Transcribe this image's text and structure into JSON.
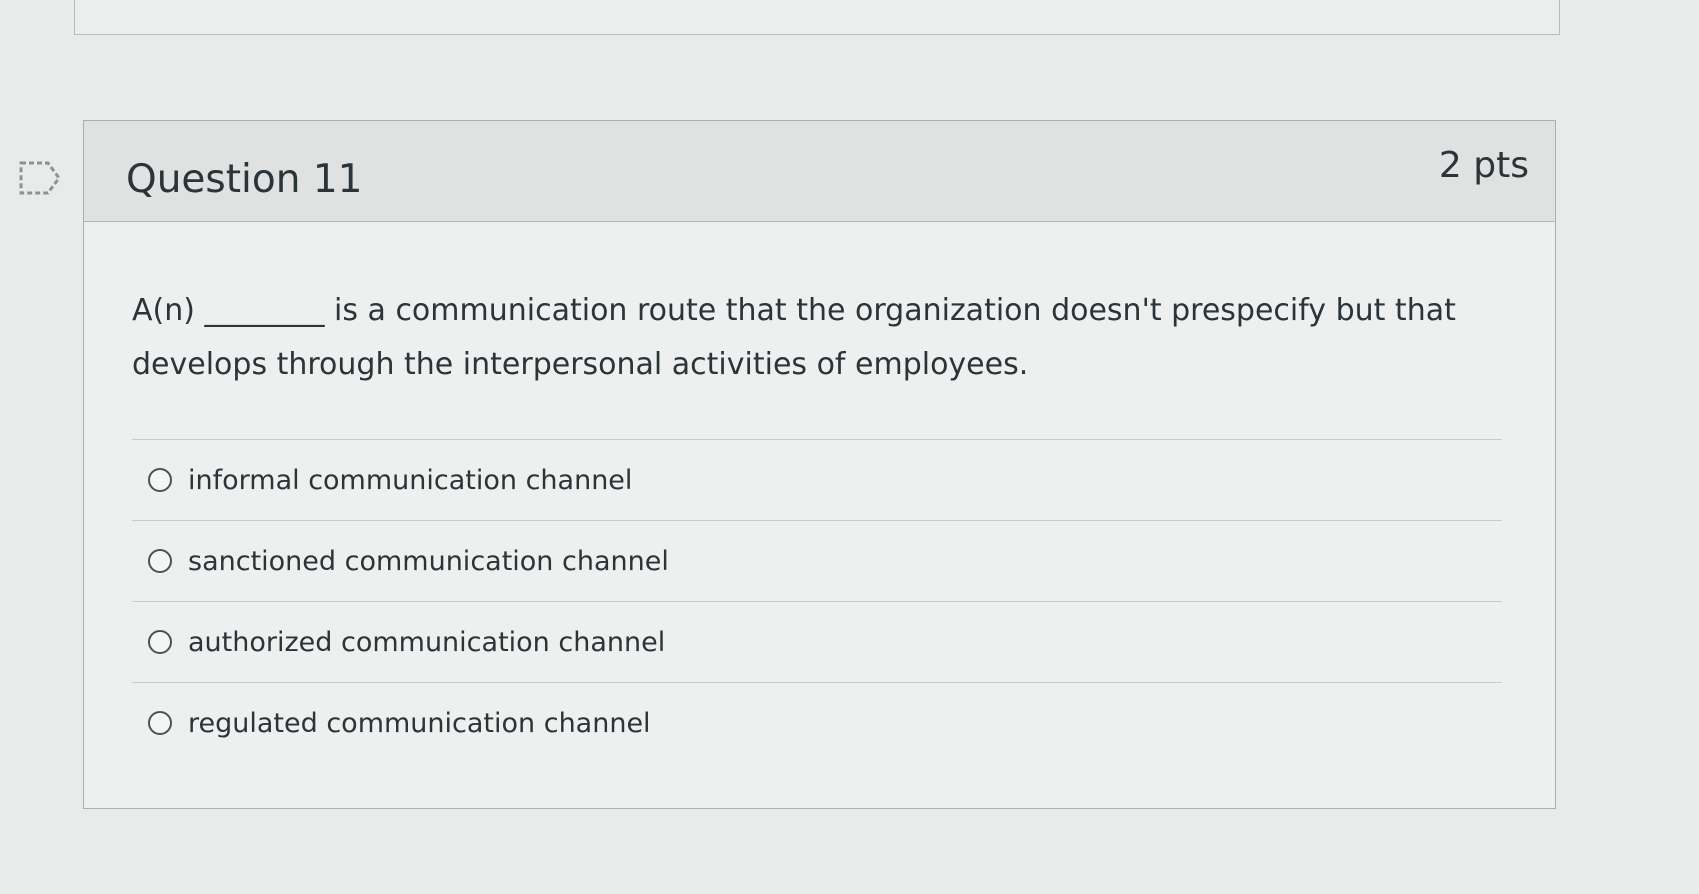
{
  "question": {
    "title": "Question 11",
    "points": "2 pts",
    "text": "A(n) ________ is a communication route that the organization doesn't prespecify but that develops through the interpersonal activities of employees."
  },
  "answers": [
    {
      "label": "informal communication channel",
      "selected": false
    },
    {
      "label": "sanctioned communication channel",
      "selected": false
    },
    {
      "label": "authorized communication channel",
      "selected": false
    },
    {
      "label": "regulated communication channel",
      "selected": false
    }
  ],
  "icons": {
    "flag": "flag-question-icon"
  },
  "colors": {
    "text": "#2b3438",
    "header_bg": "#dfe2e1",
    "card_bg": "#eef0ef",
    "border": "#a9b0ad"
  }
}
